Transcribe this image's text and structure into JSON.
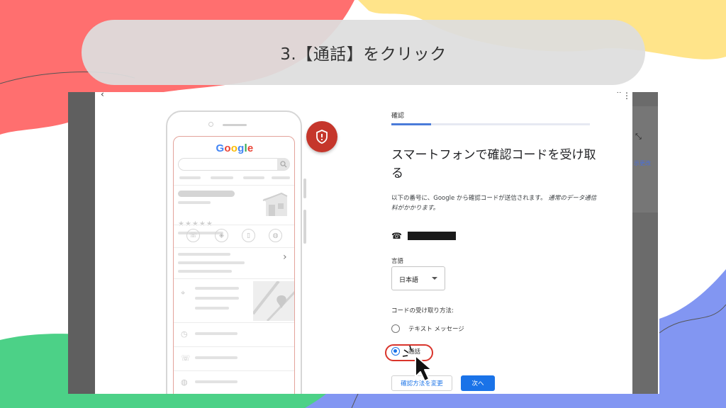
{
  "slide": {
    "title": "3.【通話】をクリック",
    "colors": {
      "red": "#ff6f6f",
      "yellow": "#ffe48a",
      "blue": "#8296f2",
      "green": "#4cd187",
      "pill": "#dedede"
    }
  },
  "phone_mock": {
    "logo": {
      "G": "G",
      "o1": "o",
      "o2": "o",
      "g": "g",
      "l": "l",
      "e": "e"
    },
    "stars": "★★★★★",
    "icons": [
      "phone-icon",
      "directions-icon",
      "bookmark-icon",
      "globe-icon",
      "location-pin-icon",
      "clock-icon",
      "phone-icon",
      "globe-icon"
    ],
    "chevron": "›",
    "badge_icon": "shield-alert-icon",
    "badge_color": "#c5362b"
  },
  "form": {
    "step_label": "確認",
    "progress_fraction": 0.2,
    "heading": "スマートフォンで確認コードを受け取る",
    "description": "以下の番号に、Google から確認コードが送信されます。",
    "description_italic": "通常のデータ通信料がかかります。",
    "phone_icon": "☎",
    "language_label": "言語",
    "language_value": "日本語",
    "method_label": "コードの受け取り方法:",
    "options": [
      {
        "label": "テキスト メッセージ",
        "selected": false
      },
      {
        "label": "通話",
        "selected": true
      }
    ],
    "change_method_button": "確認方法を変更",
    "next_button": "次へ",
    "accent": "#1a73e8",
    "highlight_color": "#d9342b"
  },
  "chrome": {
    "back_glyph": "‹",
    "more_glyph": "⋮",
    "collapse_glyph": "⌃",
    "expand_glyph": "⤡",
    "side_text": "示更改"
  }
}
